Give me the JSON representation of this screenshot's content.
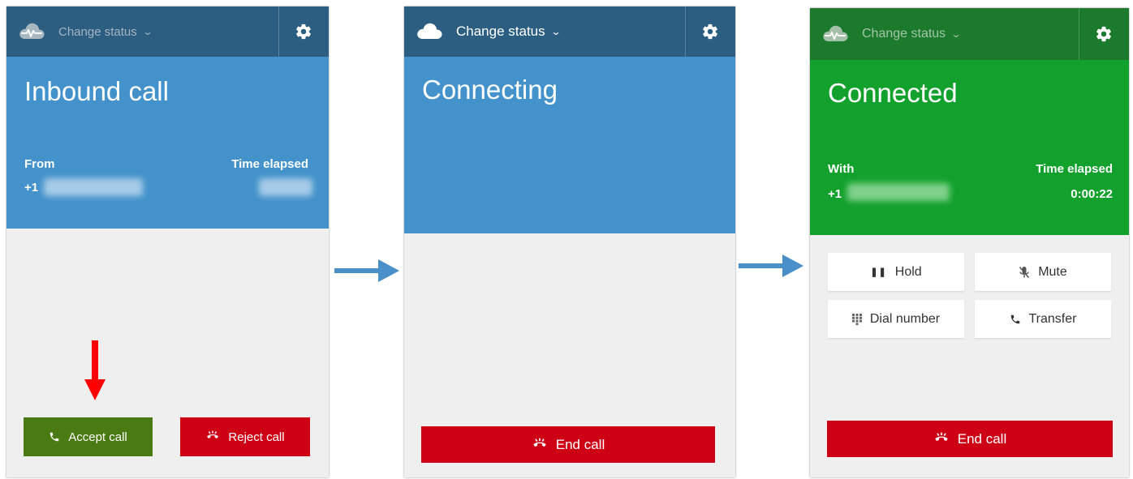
{
  "panels": [
    {
      "change_status": "Change status",
      "title": "Inbound call",
      "from_label": "From",
      "phone_prefix": "+1",
      "time_label": "Time elapsed",
      "accept_label": "Accept call",
      "reject_label": "Reject call"
    },
    {
      "change_status": "Change status",
      "title": "Connecting",
      "end_label": "End call"
    },
    {
      "change_status": "Change status",
      "title": "Connected",
      "with_label": "With",
      "phone_prefix": "+1",
      "time_label": "Time elapsed",
      "time_value": "0:00:22",
      "hold_label": "Hold",
      "mute_label": "Mute",
      "dial_label": "Dial number",
      "transfer_label": "Transfer",
      "end_label": "End call"
    }
  ],
  "colors": {
    "header_dark_blue": "#2c5e82",
    "hero_blue": "#4392cb",
    "header_dark_green": "#1b7a2c",
    "hero_green": "#12a12c",
    "end_red": "#cd0015",
    "accept_green": "#4a7b12",
    "flow_arrow": "#4a90c8",
    "indicator_arrow": "#ff0000"
  },
  "icons": {
    "logo": "cloud-heartbeat-icon",
    "settings": "gear-icon",
    "dropdown": "chevron-down-icon",
    "accept": "phone-icon",
    "end": "hangup-icon",
    "hold": "pause-icon",
    "mute": "mic-off-icon",
    "dial": "keypad-icon",
    "transfer": "transfer-icon"
  }
}
